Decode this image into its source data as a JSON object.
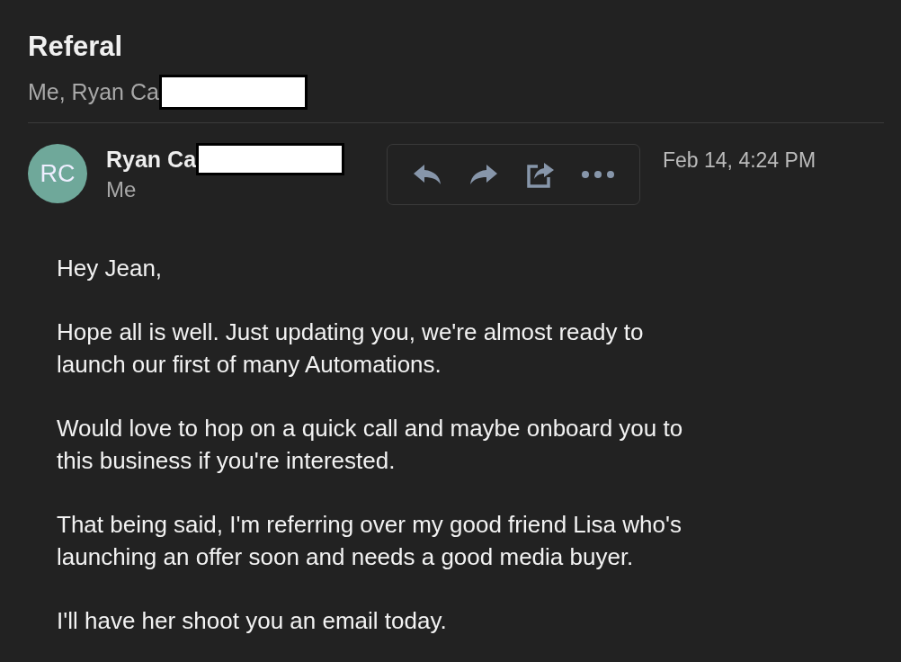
{
  "subject": "Referal",
  "participants": "Me, Ryan Ca",
  "message": {
    "avatar": "RC",
    "sender": "Ryan Ca",
    "recipient": "Me",
    "date": "Feb 14, 4:24 PM",
    "actions": [
      {
        "kind": "reply"
      },
      {
        "kind": "forward"
      },
      {
        "kind": "share"
      },
      {
        "kind": "more"
      }
    ],
    "body": [
      {
        "lines": [
          "Hey Jean,"
        ]
      },
      {
        "lines": [
          "Hope all is well. Just updating you, we're almost ready to",
          "launch our first of many Automations."
        ]
      },
      {
        "lines": [
          "Would love to hop on a quick call and maybe onboard you to",
          "this business if you're interested."
        ]
      },
      {
        "lines": [
          "That being said, I'm referring over my good friend Lisa who's",
          "launching an offer soon and needs a good media buyer."
        ]
      },
      {
        "lines": [
          "I'll have her shoot you an email today."
        ]
      }
    ]
  }
}
